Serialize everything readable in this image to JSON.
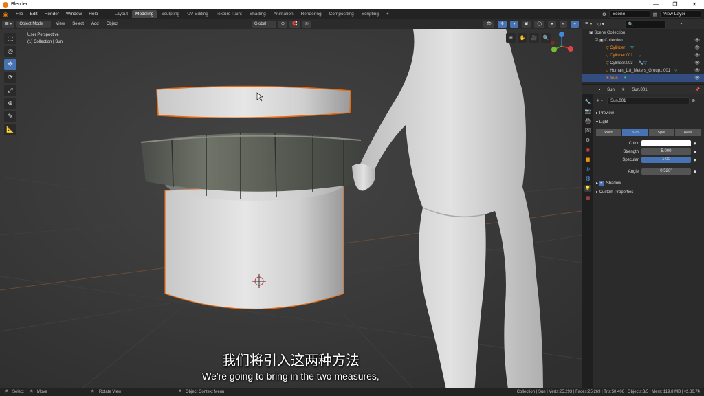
{
  "window": {
    "title": "Blender",
    "controls": [
      "—",
      "❐",
      "✕"
    ]
  },
  "menubar": {
    "items": [
      "File",
      "Edit",
      "Render",
      "Window",
      "Help"
    ],
    "workspaces": [
      "Layout",
      "Modeling",
      "Sculpting",
      "UV Editing",
      "Texture Paint",
      "Shading",
      "Animation",
      "Rendering",
      "Compositing",
      "Scripting",
      "+"
    ],
    "active_workspace": "Modeling",
    "scene": "Scene",
    "view_layer": "View Layer"
  },
  "viewport_header": {
    "mode": "Object Mode",
    "menus": [
      "View",
      "Select",
      "Add",
      "Object"
    ],
    "orientation": "Global"
  },
  "viewport": {
    "perspective": "User Perspective",
    "collection_info": "(1) Collection | Sun"
  },
  "outliner": {
    "root": "Scene Collection",
    "collection": "Collection",
    "items": [
      {
        "name": "Cylinder",
        "selected": false,
        "orange": true
      },
      {
        "name": "Cylinder.001",
        "selected": false,
        "orange": true
      },
      {
        "name": "Cylinder.003",
        "selected": false,
        "orange": false
      },
      {
        "name": "Human_1.8_Meters_Group1.001",
        "selected": false,
        "orange": false
      },
      {
        "name": "Sun",
        "selected": true,
        "orange": true
      }
    ]
  },
  "properties": {
    "object_name": "Sun",
    "data_name": "Sun.001",
    "data_field": "Sun.001",
    "sections": {
      "preview": "Preview",
      "light": "Light",
      "shadow": "Shadow",
      "custom": "Custom Properties"
    },
    "light_types": [
      "Point",
      "Sun",
      "Spot",
      "Area"
    ],
    "active_light_type": "Sun",
    "fields": {
      "color_label": "Color",
      "strength_label": "Strength",
      "strength_value": "5.000",
      "specular_label": "Specular",
      "specular_value": "1.00",
      "angle_label": "Angle",
      "angle_value": "0.526°"
    }
  },
  "statusbar": {
    "select": "Select",
    "move": "Move",
    "rotate": "Rotate View",
    "context": "Object Context Menu",
    "stats": "Collection | Sun | Verts:25,293 | Faces:25,269 | Tris:50,406 | Objects:3/5 | Mem: 119.8 MB | v2.80.74"
  },
  "subtitles": {
    "zh": "我们将引入这两种方法",
    "en": "We're going to bring in the two measures,"
  },
  "colors": {
    "accent_blue": "#4772b3",
    "select_orange": "#ff8f1f",
    "blender_orange": "#e87d0d"
  }
}
